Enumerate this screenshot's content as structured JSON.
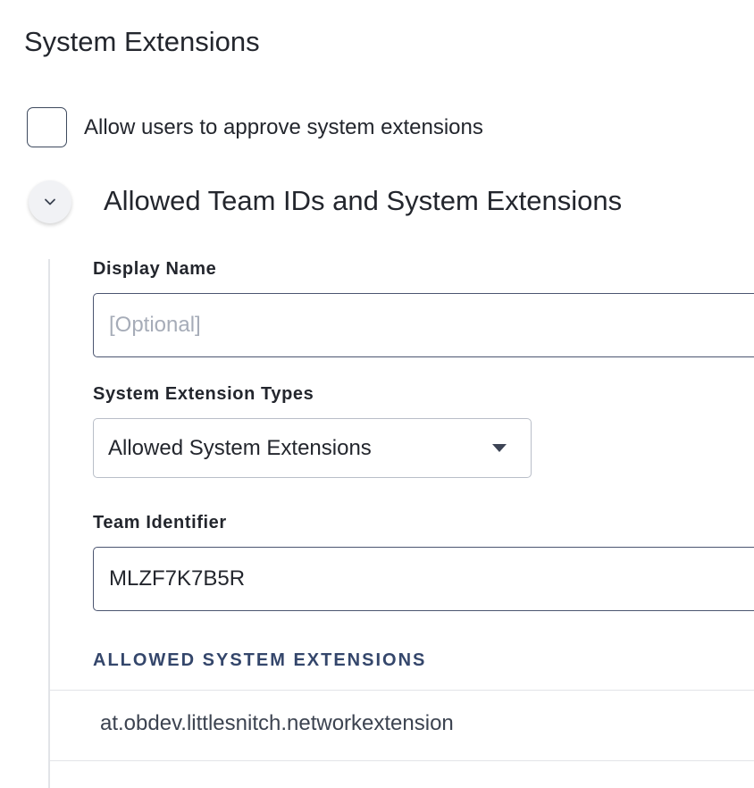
{
  "section": {
    "title": "System Extensions"
  },
  "allow_users": {
    "label": "Allow users to approve system extensions",
    "checked": false
  },
  "group": {
    "title": "Allowed Team IDs and System Extensions",
    "expanded": true,
    "toggle_icon": "chevron-down-icon"
  },
  "display_name": {
    "label": "Display Name",
    "placeholder": "[Optional]",
    "value": ""
  },
  "extension_types": {
    "label": "System Extension Types",
    "selected": "Allowed System Extensions",
    "icon": "caret-down-icon"
  },
  "team_identifier": {
    "label": "Team Identifier",
    "value": "MLZF7K7B5R"
  },
  "allowed_extensions": {
    "header": "ALLOWED SYSTEM EXTENSIONS",
    "items": [
      "at.obdev.littlesnitch.networkextension"
    ]
  },
  "colors": {
    "text": "#23262d",
    "input_border": "#4b5570",
    "list_header": "#34466b",
    "divider": "#e2e4e8"
  }
}
